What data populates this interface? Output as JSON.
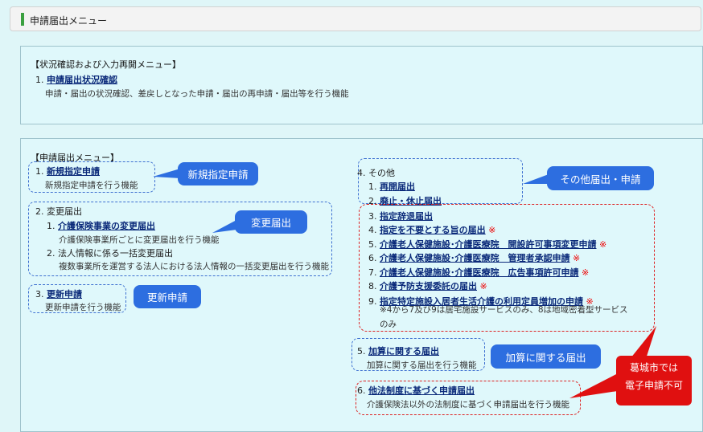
{
  "header": {
    "title": "申請届出メニュー"
  },
  "status_menu": {
    "heading": "【状況確認および入力再開メニュー】",
    "item_num": "1.",
    "item_link": "申請届出状況確認",
    "item_desc": "申請・届出の状況確認、差戻しとなった申請・届出の再申請・届出等を行う機能"
  },
  "apply_menu": {
    "heading": "【申請届出メニュー】",
    "item1": {
      "num": "1.",
      "link": "新規指定申請",
      "desc": "新規指定申請を行う機能"
    },
    "item2": {
      "num": "2.",
      "label": "変更届出",
      "sub1_num": "1.",
      "sub1_link": "介護保険事業の変更届出",
      "sub1_desc": "介護保険事業所ごとに変更届出を行う機能",
      "sub2_num": "2.",
      "sub2_label": "法人情報に係る一括変更届出",
      "sub2_desc": "複数事業所を運営する法人における法人情報の一括変更届出を行う機能"
    },
    "item3": {
      "num": "3.",
      "link": "更新申請",
      "desc": "更新申請を行う機能"
    },
    "item4": {
      "num": "4.",
      "label": "その他",
      "subs": [
        {
          "num": "1.",
          "link": "再開届出",
          "mark": ""
        },
        {
          "num": "2.",
          "link": "廃止・休止届出",
          "mark": ""
        },
        {
          "num": "3.",
          "link": "指定辞退届出",
          "mark": ""
        },
        {
          "num": "4.",
          "link": "指定を不要とする旨の届出",
          "mark": "※"
        },
        {
          "num": "5.",
          "link": "介護老人保健施設･介護医療院　開設許可事項変更申請",
          "mark": "※"
        },
        {
          "num": "6.",
          "link": "介護老人保健施設･介護医療院　管理者承認申請",
          "mark": "※"
        },
        {
          "num": "7.",
          "link": "介護老人保健施設･介護医療院　広告事項許可申請",
          "mark": "※"
        },
        {
          "num": "8.",
          "link": "介護予防支援委託の届出",
          "mark": "※"
        },
        {
          "num": "9.",
          "link": "指定特定施設入居者生活介護の利用定員増加の申請",
          "mark": "※"
        }
      ],
      "note_line1": "※4から7及び9は居宅施設サービスのみ、8は地域密着型サービス",
      "note_line2": "のみ"
    },
    "item5": {
      "num": "5.",
      "link": "加算に関する届出",
      "desc": "加算に関する届出を行う機能"
    },
    "item6": {
      "num": "6.",
      "link": "他法制度に基づく申請届出",
      "desc": "介護保険法以外の法制度に基づく申請届出を行う機能"
    }
  },
  "callouts": {
    "new": "新規指定申請",
    "change": "変更届出",
    "renew": "更新申請",
    "other": "その他届出・申請",
    "addition": "加算に関する届出",
    "city_line1": "葛城市では",
    "city_line2": "電子申請不可"
  },
  "colors": {
    "callout_blue": "#2d6ee0",
    "callout_red": "#e01010",
    "link": "#0b2a7a",
    "accent_green": "#3aa040"
  }
}
